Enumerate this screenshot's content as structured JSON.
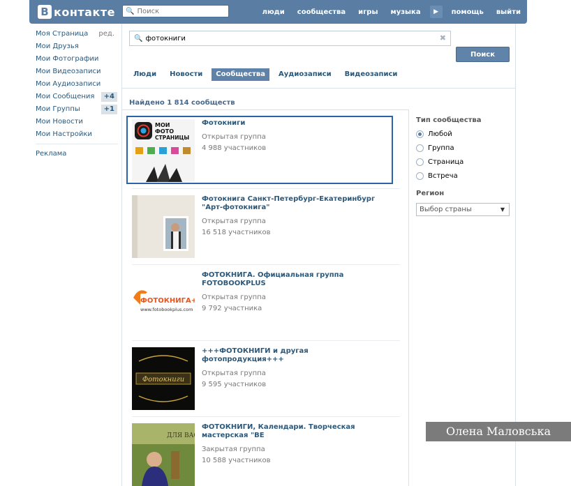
{
  "header": {
    "logo_letter": "В",
    "logo_text": "контакте",
    "search_placeholder": "Поиск",
    "nav": [
      "люди",
      "сообщества",
      "игры",
      "музыка",
      "помощь",
      "выйти"
    ]
  },
  "sidebar": {
    "items": [
      {
        "label": "Моя Страница",
        "extra": "ред."
      },
      {
        "label": "Мои Друзья"
      },
      {
        "label": "Мои Фотографии"
      },
      {
        "label": "Мои Видеозаписи"
      },
      {
        "label": "Мои Аудиозаписи"
      },
      {
        "label": "Мои Сообщения",
        "badge": "+4"
      },
      {
        "label": "Мои Группы",
        "badge": "+1"
      },
      {
        "label": "Мои Новости"
      },
      {
        "label": "Мои Настройки"
      }
    ],
    "ads": "Реклама"
  },
  "search": {
    "query": "фотокниги",
    "button": "Поиск"
  },
  "tabs": [
    "Люди",
    "Новости",
    "Сообщества",
    "Аудиозаписи",
    "Видеозаписи"
  ],
  "found": "Найдено 1 814 сообществ",
  "results": [
    {
      "name": "Фотокниги",
      "type": "Открытая группа",
      "count": "4 988 участников",
      "thumb_title": "МОИ\nФОТО\nСТРАНИЦЫ"
    },
    {
      "name": "Фотокнига Санкт-Петербург-Екатеринбург \"Арт-фотокнига\"",
      "type": "Открытая группа",
      "count": "16 518 участников"
    },
    {
      "name": "ФОТОКНИГА. Официальная группа FOTOBOOKPLUS",
      "type": "Открытая группа",
      "count": "9 792 участника",
      "thumb_logo": "ФОТОКНИГА+",
      "thumb_url": "www.fotobookplus.com"
    },
    {
      "name": "+++ФОТОКНИГИ и другая фотопродукция+++",
      "type": "Открытая группа",
      "count": "9 595 участников",
      "thumb_text": "Фотокниги"
    },
    {
      "name": "ФОТОКНИГИ, Календари. Творческая мастерская \"ВЕ",
      "type": "Закрытая группа",
      "count": "10 588 участников",
      "thumb_text": "ДЛЯ ВАС"
    }
  ],
  "filters": {
    "type_title": "Тип сообщества",
    "types": [
      "Любой",
      "Группа",
      "Страница",
      "Встреча"
    ],
    "selected_type": "Любой",
    "region_title": "Регион",
    "region_value": "Выбор страны"
  },
  "watermark": "Олена Маловська",
  "colors": {
    "brand": "#597da3",
    "link": "#2b587a",
    "highlight": "#2b63a8"
  }
}
